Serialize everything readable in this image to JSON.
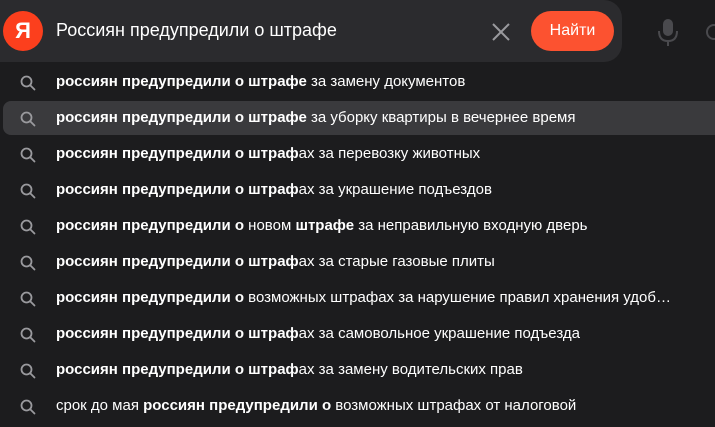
{
  "search": {
    "logo_letter": "Я",
    "query": "Россиян предупредили о штрафе",
    "submit_label": "Найти"
  },
  "colors": {
    "accent": "#fc5230",
    "logo": "#fc3f1d",
    "background": "#1c1c1e",
    "highlight": "#3a3a3d"
  },
  "icons": {
    "clear": "close-icon",
    "voice": "microphone-icon",
    "suggestion": "search-icon"
  },
  "suggestions": [
    {
      "active": false,
      "parts": [
        {
          "t": "россиян предупредили о штрафе",
          "b": true
        },
        {
          "t": " за замену документов",
          "b": false
        }
      ]
    },
    {
      "active": true,
      "parts": [
        {
          "t": "россиян предупредили о штрафе",
          "b": true
        },
        {
          "t": " за уборку квартиры в вечернее время",
          "b": false
        }
      ]
    },
    {
      "active": false,
      "parts": [
        {
          "t": "россиян предупредили о штраф",
          "b": true
        },
        {
          "t": "ах за перевозку животных",
          "b": false
        }
      ]
    },
    {
      "active": false,
      "parts": [
        {
          "t": "россиян предупредили о штраф",
          "b": true
        },
        {
          "t": "ах за украшение подъездов",
          "b": false
        }
      ]
    },
    {
      "active": false,
      "parts": [
        {
          "t": "россиян предупредили о",
          "b": true
        },
        {
          "t": " новом ",
          "b": false
        },
        {
          "t": "штрафе",
          "b": true
        },
        {
          "t": " за неправильную входную дверь",
          "b": false
        }
      ]
    },
    {
      "active": false,
      "parts": [
        {
          "t": "россиян предупредили о штраф",
          "b": true
        },
        {
          "t": "ах за старые газовые плиты",
          "b": false
        }
      ]
    },
    {
      "active": false,
      "parts": [
        {
          "t": "россиян предупредили о",
          "b": true
        },
        {
          "t": " возможных штрафах за нарушение правил хранения удоб…",
          "b": false
        }
      ]
    },
    {
      "active": false,
      "parts": [
        {
          "t": "россиян предупредили о штраф",
          "b": true
        },
        {
          "t": "ах за самовольное украшение подъезда",
          "b": false
        }
      ]
    },
    {
      "active": false,
      "parts": [
        {
          "t": "россиян предупредили о штраф",
          "b": true
        },
        {
          "t": "ах за замену водительских прав",
          "b": false
        }
      ]
    },
    {
      "active": false,
      "parts": [
        {
          "t": "срок до мая ",
          "b": false
        },
        {
          "t": "россиян предупредили о",
          "b": true
        },
        {
          "t": " возможных штрафах от налоговой",
          "b": false
        }
      ]
    }
  ]
}
